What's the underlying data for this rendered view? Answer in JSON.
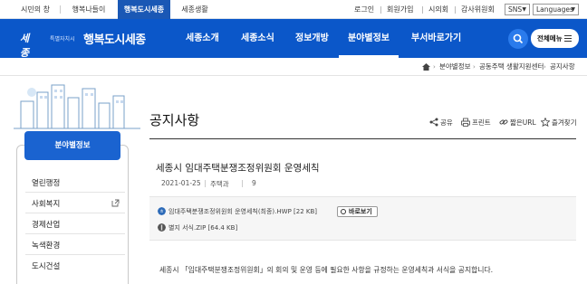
{
  "topbar": {
    "tabs": [
      {
        "label": "시민의 창"
      },
      {
        "label": "행복나들이"
      },
      {
        "label": "행복도시세종"
      },
      {
        "label": "세종생활"
      }
    ],
    "utility": {
      "login": "로그인",
      "join": "회원가입",
      "city_council": "시의회",
      "audit": "감사위원회"
    },
    "sns_select": "SNS",
    "languages_select": "Languages"
  },
  "navbar": {
    "logo_sejong": "세종",
    "logo_small": "특별자치시",
    "logo_main": "행복도시세종",
    "menus": [
      "세종소개",
      "세종소식",
      "정보개방",
      "분야별정보",
      "부서바로가기"
    ],
    "active_menu": "분야별정보",
    "all_menu": "전체메뉴"
  },
  "breadcrumb": [
    "분야별정보",
    "공동주택 생활지원센터",
    "공지사항"
  ],
  "sidebar": {
    "title": "분야별정보",
    "items": [
      {
        "label": "열린행정"
      },
      {
        "label": "사회복지"
      },
      {
        "label": "경제산업"
      },
      {
        "label": "녹색환경"
      },
      {
        "label": "도시건설"
      }
    ]
  },
  "content": {
    "page_title": "공지사항",
    "tools": {
      "share": "공유",
      "print": "프린트",
      "short_url": "짧은URL",
      "favorite": "즐겨찾기"
    },
    "post": {
      "title": "세종시 임대주택분쟁조정위원회 운영세칙",
      "date": "2021-01-25",
      "dept": "주택과",
      "views": "9"
    },
    "attachments": [
      {
        "name": "임대주택분쟁조정위원회 운영세칙(최종).HWP [22 KB]",
        "icon": "hwp-file-icon"
      },
      {
        "name": "별지 서식.ZIP [64.4 KB]",
        "icon": "zip-file-icon"
      }
    ],
    "preview_label": "바로보기",
    "body": "세종시 「임대주택분쟁조정위원회」의 회의 및 운영 등에 필요한 사항을 규정하는 운영세칙과 서식을 공지합니다."
  },
  "colors": {
    "brand": "#0b57c9",
    "active_tab": "#1a58b5",
    "sidebar_header": "#1a63d0"
  }
}
